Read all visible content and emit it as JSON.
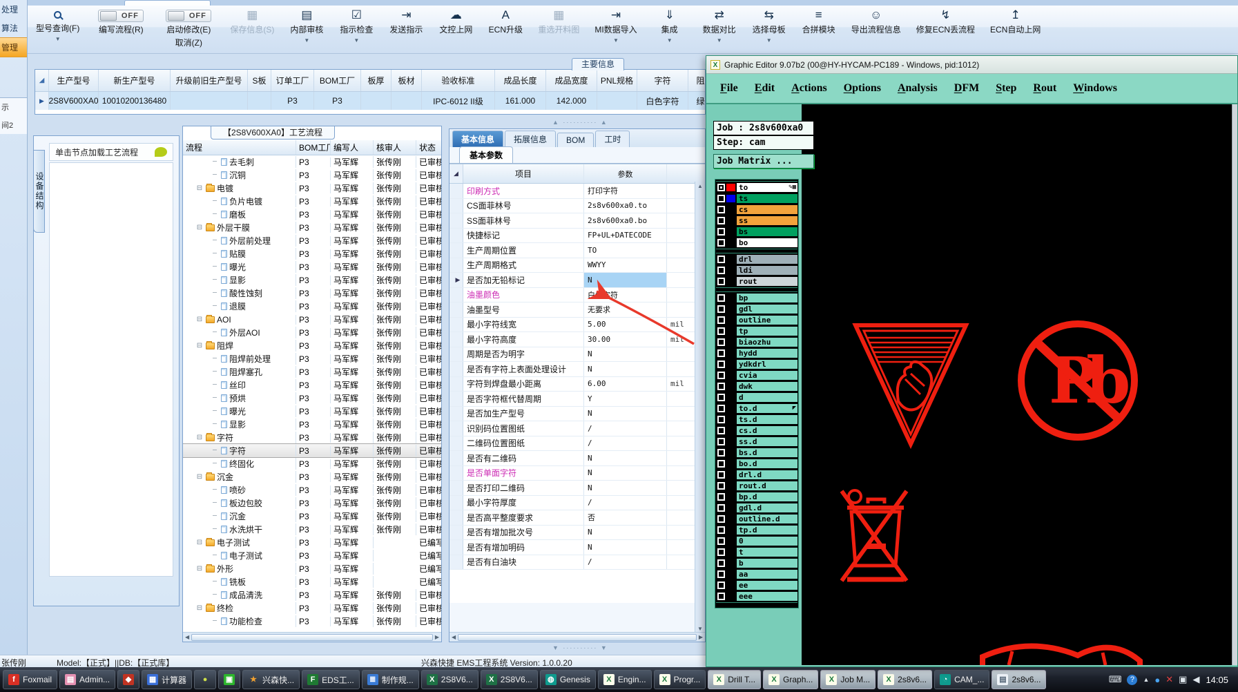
{
  "left_rail": {
    "items": [
      {
        "label": "处理",
        "active": false
      },
      {
        "label": "算法",
        "active": false
      },
      {
        "label": "管理",
        "active": true
      }
    ],
    "lower_items": [
      "示",
      "间2"
    ]
  },
  "ribbon": {
    "buttons": [
      {
        "label": "型号查询(F)",
        "icon": "magnifier-icon",
        "dropdown": true
      },
      {
        "label": "编写流程(R)",
        "icon": "toggle-off-switch",
        "toggle": true,
        "state": "OFF"
      },
      {
        "label": "启动修改(E)",
        "label2": "取消(Z)",
        "icon": "toggle-off-switch",
        "toggle": true,
        "state": "OFF"
      },
      {
        "label": "保存信息(S)",
        "icon": "save-icon",
        "disabled": true
      },
      {
        "label": "内部审核",
        "icon": "printer-icon",
        "dropdown": true
      },
      {
        "label": "指示检查",
        "icon": "checkbox-icon",
        "dropdown": true
      },
      {
        "label": "发送指示",
        "icon": "send-icon"
      },
      {
        "label": "文控上网",
        "icon": "cloud-upload-icon"
      },
      {
        "label": "ECN升级",
        "icon": "font-a-icon"
      },
      {
        "label": "重选开料图",
        "icon": "image-icon",
        "disabled": true
      },
      {
        "label": "MI数据导入",
        "icon": "import-icon",
        "dropdown": true
      },
      {
        "label": "集成",
        "icon": "download-icon",
        "dropdown": true
      },
      {
        "label": "数据对比",
        "icon": "compare-icon",
        "dropdown": true
      },
      {
        "label": "选择母板",
        "icon": "shuffle-icon",
        "dropdown": true
      },
      {
        "label": "合拼模块",
        "icon": "list-icon"
      },
      {
        "label": "导出流程信息",
        "icon": "smiley-icon"
      },
      {
        "label": "修复ECN丢流程",
        "icon": "repair-icon"
      },
      {
        "label": "ECN自动上网",
        "icon": "upload-icon"
      }
    ]
  },
  "model_table": {
    "headers": [
      "",
      "生产型号",
      "新生产型号",
      "升级前旧生产型号",
      "S板",
      "订单工厂",
      "BOM工厂",
      "板厚",
      "板材",
      "验收标准",
      "成品长度",
      "成品宽度",
      "PNL规格",
      "字符",
      "阻焊"
    ],
    "row": [
      "",
      "2S8V600XA0",
      "10010200136480",
      "",
      "",
      "P3",
      "P3",
      "",
      "",
      "IPC-6012 II级",
      "161.000",
      "142.000",
      "",
      "白色字符",
      "绿色"
    ]
  },
  "info_tab": "主要信息",
  "device_panel": {
    "tab": "设备结构",
    "hint": "单击节点加载工艺流程"
  },
  "flow_panel": {
    "title": "【2S8V600XA0】工艺流程",
    "headers": [
      "流程",
      "BOM工厂",
      "编写人",
      "核审人",
      "状态"
    ],
    "rows": [
      {
        "name": "去毛刺",
        "type": "leaf",
        "bom": "P3",
        "writer": "马军辉",
        "reviewer": "张传刚",
        "status": "已审核"
      },
      {
        "name": "沉铜",
        "type": "leaf",
        "bom": "P3",
        "writer": "马军辉",
        "reviewer": "张传刚",
        "status": "已审核"
      },
      {
        "name": "电镀",
        "type": "folder",
        "bom": "P3",
        "writer": "马军辉",
        "reviewer": "张传刚",
        "status": "已审核"
      },
      {
        "name": "负片电镀",
        "type": "leaf",
        "bom": "P3",
        "writer": "马军辉",
        "reviewer": "张传刚",
        "status": "已审核"
      },
      {
        "name": "磨板",
        "type": "leaf",
        "bom": "P3",
        "writer": "马军辉",
        "reviewer": "张传刚",
        "status": "已审核"
      },
      {
        "name": "外层干膜",
        "type": "folder",
        "bom": "P3",
        "writer": "马军辉",
        "reviewer": "张传刚",
        "status": "已审核"
      },
      {
        "name": "外层前处理",
        "type": "leaf",
        "bom": "P3",
        "writer": "马军辉",
        "reviewer": "张传刚",
        "status": "已审核"
      },
      {
        "name": "贴膜",
        "type": "leaf",
        "bom": "P3",
        "writer": "马军辉",
        "reviewer": "张传刚",
        "status": "已审核"
      },
      {
        "name": "曝光",
        "type": "leaf",
        "bom": "P3",
        "writer": "马军辉",
        "reviewer": "张传刚",
        "status": "已审核"
      },
      {
        "name": "显影",
        "type": "leaf",
        "bom": "P3",
        "writer": "马军辉",
        "reviewer": "张传刚",
        "status": "已审核"
      },
      {
        "name": "酸性蚀刻",
        "type": "leaf",
        "bom": "P3",
        "writer": "马军辉",
        "reviewer": "张传刚",
        "status": "已审核"
      },
      {
        "name": "退膜",
        "type": "leaf",
        "bom": "P3",
        "writer": "马军辉",
        "reviewer": "张传刚",
        "status": "已审核"
      },
      {
        "name": "AOI",
        "type": "folder",
        "bom": "P3",
        "writer": "马军辉",
        "reviewer": "张传刚",
        "status": "已审核"
      },
      {
        "name": "外层AOI",
        "type": "leaf",
        "bom": "P3",
        "writer": "马军辉",
        "reviewer": "张传刚",
        "status": "已审核"
      },
      {
        "name": "阻焊",
        "type": "folder",
        "bom": "P3",
        "writer": "马军辉",
        "reviewer": "张传刚",
        "status": "已审核"
      },
      {
        "name": "阻焊前处理",
        "type": "leaf",
        "bom": "P3",
        "writer": "马军辉",
        "reviewer": "张传刚",
        "status": "已审核"
      },
      {
        "name": "阻焊塞孔",
        "type": "leaf",
        "bom": "P3",
        "writer": "马军辉",
        "reviewer": "张传刚",
        "status": "已审核"
      },
      {
        "name": "丝印",
        "type": "leaf",
        "bom": "P3",
        "writer": "马军辉",
        "reviewer": "张传刚",
        "status": "已审核"
      },
      {
        "name": "预烘",
        "type": "leaf",
        "bom": "P3",
        "writer": "马军辉",
        "reviewer": "张传刚",
        "status": "已审核"
      },
      {
        "name": "曝光",
        "type": "leaf",
        "bom": "P3",
        "writer": "马军辉",
        "reviewer": "张传刚",
        "status": "已审核"
      },
      {
        "name": "显影",
        "type": "leaf",
        "bom": "P3",
        "writer": "马军辉",
        "reviewer": "张传刚",
        "status": "已审核"
      },
      {
        "name": "字符",
        "type": "folder",
        "bom": "P3",
        "writer": "马军辉",
        "reviewer": "张传刚",
        "status": "已审核"
      },
      {
        "name": "字符",
        "type": "leaf",
        "bom": "P3",
        "writer": "马军辉",
        "reviewer": "张传刚",
        "status": "已审核",
        "selected": true
      },
      {
        "name": "终固化",
        "type": "leaf",
        "bom": "P3",
        "writer": "马军辉",
        "reviewer": "张传刚",
        "status": "已审核"
      },
      {
        "name": "沉金",
        "type": "folder",
        "bom": "P3",
        "writer": "马军辉",
        "reviewer": "张传刚",
        "status": "已审核"
      },
      {
        "name": "喷砂",
        "type": "leaf",
        "bom": "P3",
        "writer": "马军辉",
        "reviewer": "张传刚",
        "status": "已审核"
      },
      {
        "name": "板边包胶",
        "type": "leaf",
        "bom": "P3",
        "writer": "马军辉",
        "reviewer": "张传刚",
        "status": "已审核"
      },
      {
        "name": "沉金",
        "type": "leaf",
        "bom": "P3",
        "writer": "马军辉",
        "reviewer": "张传刚",
        "status": "已审核"
      },
      {
        "name": "水洗烘干",
        "type": "leaf",
        "bom": "P3",
        "writer": "马军辉",
        "reviewer": "张传刚",
        "status": "已审核"
      },
      {
        "name": "电子测试",
        "type": "folder",
        "bom": "P3",
        "writer": "马军辉",
        "reviewer": "",
        "status": "已编写"
      },
      {
        "name": "电子测试",
        "type": "leaf",
        "bom": "P3",
        "writer": "马军辉",
        "reviewer": "",
        "status": "已编写"
      },
      {
        "name": "外形",
        "type": "folder",
        "bom": "P3",
        "writer": "马军辉",
        "reviewer": "",
        "status": "已编写"
      },
      {
        "name": "铣板",
        "type": "leaf",
        "bom": "P3",
        "writer": "马军辉",
        "reviewer": "",
        "status": "已编写"
      },
      {
        "name": "成品清洗",
        "type": "leaf",
        "bom": "P3",
        "writer": "马军辉",
        "reviewer": "张传刚",
        "status": "已审核"
      },
      {
        "name": "终检",
        "type": "folder",
        "bom": "P3",
        "writer": "马军辉",
        "reviewer": "张传刚",
        "status": "已审核"
      },
      {
        "name": "功能检查",
        "type": "leaf",
        "bom": "P3",
        "writer": "马军辉",
        "reviewer": "张传刚",
        "status": "已审核"
      }
    ]
  },
  "param_panel": {
    "tabs": [
      {
        "label": "基本信息",
        "active": true
      },
      {
        "label": "拓展信息",
        "active": false
      },
      {
        "label": "BOM",
        "active": false
      },
      {
        "label": "工时",
        "active": false
      }
    ],
    "subtab": "基本参数",
    "headers": [
      "项目",
      "参数"
    ],
    "rows": [
      {
        "item": "印刷方式",
        "value": "打印字符",
        "magenta": true
      },
      {
        "item": "CS面菲林号",
        "value": "2s8v600xa0.to"
      },
      {
        "item": "SS面菲林号",
        "value": "2s8v600xa0.bo"
      },
      {
        "item": "快捷标记",
        "value": "FP+UL+DATECODE"
      },
      {
        "item": "生产周期位置",
        "value": "TO"
      },
      {
        "item": "生产周期格式",
        "value": "WWYY"
      },
      {
        "item": "是否加无铅标记",
        "value": "N",
        "selected": true
      },
      {
        "item": "油墨颜色",
        "value": "白色字符",
        "magenta": true
      },
      {
        "item": "油墨型号",
        "value": "无要求"
      },
      {
        "item": "最小字符线宽",
        "value": "5.00",
        "unit": "mil"
      },
      {
        "item": "最小字符高度",
        "value": "30.00",
        "unit": "mil"
      },
      {
        "item": "周期是否为明字",
        "value": "N"
      },
      {
        "item": "是否有字符上表面处理设计",
        "value": "N"
      },
      {
        "item": "字符到焊盘最小距离",
        "value": "6.00",
        "unit": "mil"
      },
      {
        "item": "是否字符框代替周期",
        "value": "Y"
      },
      {
        "item": "是否加生产型号",
        "value": "N"
      },
      {
        "item": "识别码位置图纸",
        "value": "/"
      },
      {
        "item": "二维码位置图纸",
        "value": "/"
      },
      {
        "item": "是否有二维码",
        "value": "N"
      },
      {
        "item": "是否单面字符",
        "value": "N",
        "magenta": true
      },
      {
        "item": "是否打印二维码",
        "value": "N"
      },
      {
        "item": "最小字符厚度",
        "value": "/"
      },
      {
        "item": "是否高平整度要求",
        "value": "否"
      },
      {
        "item": "是否有增加批次号",
        "value": "N"
      },
      {
        "item": "是否有增加明码",
        "value": "N"
      },
      {
        "item": "是否有白油块",
        "value": "/"
      }
    ]
  },
  "status_bar": {
    "user": "张传刚",
    "model_db": "Model:【正式】||DB:【正式库】",
    "version": "兴森快捷  EMS工程系统  Version: 1.0.0.20"
  },
  "editor": {
    "title": "Graphic Editor 9.07b2 (00@HY-HYCAM-PC189 - Windows, pid:1012)",
    "menus": [
      "File",
      "Edit",
      "Actions",
      "Options",
      "Analysis",
      "DFM",
      "Step",
      "Rout",
      "Windows"
    ],
    "job_label": "Job : 2s8v600xa0",
    "step_label": "Step: cam",
    "matrix_button": "Job Matrix ...",
    "layer_groups": [
      [
        {
          "name": "to",
          "chip": "#ff0000",
          "bg": "#ffffff",
          "checked": true,
          "extras": "✎▦"
        },
        {
          "name": "ts",
          "chip": "#0000ee",
          "bg": "#00a05f"
        },
        {
          "name": "cs",
          "chip": "",
          "bg": "#f2a33c"
        },
        {
          "name": "ss",
          "chip": "",
          "bg": "#f2a33c"
        },
        {
          "name": "bs",
          "chip": "",
          "bg": "#00a05f"
        },
        {
          "name": "bo",
          "chip": "",
          "bg": "#ffffff"
        }
      ],
      [
        {
          "name": "drl",
          "chip": "",
          "bg": "#9fb0b8"
        },
        {
          "name": "ldi",
          "chip": "",
          "bg": "#9fb0b8"
        },
        {
          "name": "rout",
          "chip": "",
          "bg": "#cdd5d9"
        }
      ],
      [
        {
          "name": "bp",
          "chip": "",
          "bg": "#7fd9c3"
        },
        {
          "name": "gdl",
          "chip": "",
          "bg": "#7fd9c3"
        },
        {
          "name": "outline",
          "chip": "",
          "bg": "#7fd9c3"
        },
        {
          "name": "tp",
          "chip": "",
          "bg": "#7fd9c3"
        },
        {
          "name": "biaozhu",
          "chip": "",
          "bg": "#7fd9c3"
        },
        {
          "name": "hydd",
          "chip": "",
          "bg": "#7fd9c3"
        },
        {
          "name": "ydkdrl",
          "chip": "",
          "bg": "#7fd9c3"
        },
        {
          "name": "cvia",
          "chip": "",
          "bg": "#7fd9c3"
        },
        {
          "name": "dwk",
          "chip": "",
          "bg": "#7fd9c3"
        },
        {
          "name": "d",
          "chip": "",
          "bg": "#7fd9c3"
        },
        {
          "name": "to.d",
          "chip": "",
          "bg": "#7fd9c3",
          "extras": "◤"
        },
        {
          "name": "ts.d",
          "chip": "",
          "bg": "#7fd9c3"
        },
        {
          "name": "cs.d",
          "chip": "",
          "bg": "#7fd9c3"
        },
        {
          "name": "ss.d",
          "chip": "",
          "bg": "#7fd9c3"
        },
        {
          "name": "bs.d",
          "chip": "",
          "bg": "#7fd9c3"
        },
        {
          "name": "bo.d",
          "chip": "",
          "bg": "#7fd9c3"
        },
        {
          "name": "drl.d",
          "chip": "",
          "bg": "#7fd9c3"
        },
        {
          "name": "rout.d",
          "chip": "",
          "bg": "#7fd9c3"
        },
        {
          "name": "bp.d",
          "chip": "",
          "bg": "#7fd9c3"
        },
        {
          "name": "gdl.d",
          "chip": "",
          "bg": "#7fd9c3"
        },
        {
          "name": "outline.d",
          "chip": "",
          "bg": "#7fd9c3"
        },
        {
          "name": "tp.d",
          "chip": "",
          "bg": "#7fd9c3"
        },
        {
          "name": "0",
          "chip": "",
          "bg": "#7fd9c3"
        },
        {
          "name": "t",
          "chip": "",
          "bg": "#7fd9c3"
        },
        {
          "name": "b",
          "chip": "",
          "bg": "#7fd9c3"
        },
        {
          "name": "aa",
          "chip": "",
          "bg": "#7fd9c3"
        },
        {
          "name": "ee",
          "chip": "",
          "bg": "#7fd9c3"
        },
        {
          "name": "eee",
          "chip": "",
          "bg": "#7fd9c3"
        }
      ]
    ],
    "symbols": [
      "crush-warning-triangle",
      "lead-free-pb-symbol",
      "weee-crossed-bin-symbol",
      "partial-red-symbol"
    ],
    "symbol_color": "#ef1f10"
  },
  "taskbar": {
    "items": [
      {
        "label": "Foxmail",
        "icon": "foxmail-icon"
      },
      {
        "label": "Admin...",
        "icon": "floppy-icon"
      },
      {
        "label": "",
        "icon": "red-shield-icon"
      },
      {
        "label": "计算器",
        "icon": "calculator-icon"
      },
      {
        "label": "",
        "icon": "yellow-ball-icon"
      },
      {
        "label": "",
        "icon": "green-square-icon"
      },
      {
        "label": "兴森快...",
        "icon": "orange-star-icon"
      },
      {
        "label": "EDS工...",
        "icon": "f-green-icon"
      },
      {
        "label": "制作规...",
        "icon": "blue-doc-icon"
      },
      {
        "label": "2S8V6...",
        "icon": "excel-icon"
      },
      {
        "label": "2S8V6...",
        "icon": "excel-icon"
      },
      {
        "label": "Genesis",
        "icon": "globe-icon"
      },
      {
        "label": "Engin...",
        "icon": "xwin-icon"
      },
      {
        "label": "Progr...",
        "icon": "xwin-icon"
      },
      {
        "label": "Drill T...",
        "icon": "xwin-icon",
        "active": true
      },
      {
        "label": "Graph...",
        "icon": "xwin-icon",
        "active": true
      },
      {
        "label": "Job M...",
        "icon": "xwin-icon",
        "active": true
      },
      {
        "label": "2s8v6...",
        "icon": "xwin-icon",
        "active": true
      },
      {
        "label": "CAM_...",
        "icon": "cam-icon"
      },
      {
        "label": "2s8v6...",
        "icon": "notepad-icon",
        "active": true
      }
    ],
    "tray_icons": [
      "keyboard-icon",
      "help-icon",
      "expand-arrow-icon",
      "messenger-icon",
      "alert-icon",
      "network-icon",
      "volume-icon"
    ],
    "clock": "14:05"
  }
}
